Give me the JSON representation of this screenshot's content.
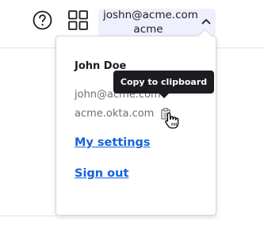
{
  "header": {
    "help_icon": "help-circle-icon",
    "apps_icon": "apps-grid-icon",
    "account": {
      "email": "joshn@acme.com",
      "org": "acme",
      "chevron_icon": "chevron-up-icon"
    }
  },
  "dropdown": {
    "name": "John Doe",
    "email": "john@acme.com",
    "org_domain": "acme.okta.com",
    "copy_icon": "clipboard-icon",
    "settings_link": "My settings",
    "signout_link": "Sign out"
  },
  "tooltip": {
    "text": "Copy to clipboard"
  },
  "colors": {
    "account_bg": "#eef0fd",
    "link": "#1662dd",
    "tooltip_bg": "#1d1d21",
    "muted_text": "#6e6e78"
  }
}
